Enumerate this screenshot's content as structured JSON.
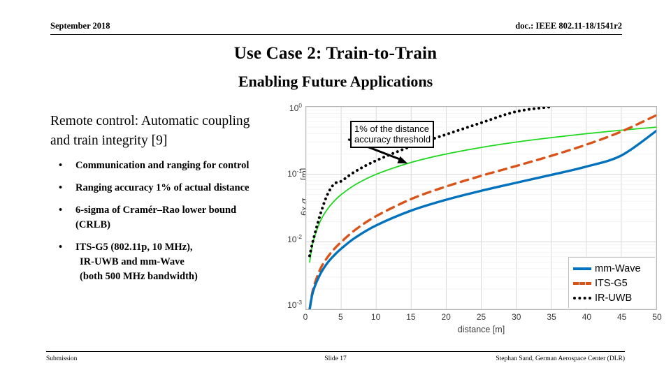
{
  "header": {
    "date": "September 2018",
    "doc": "doc.: IEEE 802.11-18/1541r2"
  },
  "title": {
    "main": "Use Case 2: Train-to-Train",
    "sub": "Enabling Future Applications"
  },
  "content": {
    "lead": "Remote control: Automatic coupling and train integrity [9]",
    "bullets": [
      {
        "marker": "•",
        "text": "Communication and ranging for control"
      },
      {
        "marker": "•",
        "text": "Ranging accuracy 1% of actual distance"
      },
      {
        "marker": "•",
        "text": "6-sigma of Cramér–Rao lower bound (CRLB)"
      },
      {
        "marker": "•",
        "text": "ITS-G5 (802.11p, 10 MHz),",
        "sub1": "IR-UWB and mm-Wave",
        "sub2": "(both 500 MHz bandwidth)"
      }
    ]
  },
  "figure": {
    "callout": {
      "line1": "1% of the distance",
      "line2": "accuracy threshold"
    },
    "yticks": [
      {
        "mant": "10",
        "exp": "0"
      },
      {
        "mant": "10",
        "exp": "-1"
      },
      {
        "mant": "10",
        "exp": "-2"
      },
      {
        "mant": "10",
        "exp": "-3"
      }
    ],
    "xticks": [
      "0",
      "5",
      "10",
      "15",
      "20",
      "25",
      "30",
      "35",
      "40",
      "45",
      "50"
    ]
  },
  "chart_data": {
    "type": "line",
    "title": "",
    "xlabel": "distance [m]",
    "ylabel": "6x σCRLB [m]",
    "yscale": "log",
    "xlim": [
      0,
      50
    ],
    "ylim": [
      0.001,
      1
    ],
    "grid": true,
    "legend_position": "bottom-right",
    "legend_entries": [
      "mm-Wave",
      "ITS-G5",
      "IR-UWB"
    ],
    "colors": {
      "mm_wave": "#0072bd",
      "its_g5": "#d95319",
      "ir_uwb": "#000000",
      "threshold": "#1ed81e"
    },
    "x": [
      0.5,
      1,
      2,
      3,
      4,
      5,
      7,
      10,
      15,
      20,
      25,
      30,
      35,
      40,
      45,
      50
    ],
    "series": [
      {
        "name": "mm-Wave",
        "style": "solid",
        "color": "#0072bd",
        "values": [
          0.001,
          0.00185,
          0.0033,
          0.0048,
          0.0063,
          0.0079,
          0.0115,
          0.0175,
          0.029,
          0.042,
          0.057,
          0.075,
          0.098,
          0.13,
          0.19,
          0.44
        ]
      },
      {
        "name": "ITS-G5",
        "style": "dashed",
        "color": "#d95319",
        "values": [
          0.001,
          0.002,
          0.0039,
          0.0058,
          0.0078,
          0.0099,
          0.015,
          0.024,
          0.043,
          0.066,
          0.095,
          0.133,
          0.188,
          0.275,
          0.43,
          0.75
        ]
      },
      {
        "name": "IR-UWB",
        "style": "dotted",
        "color": "#000000",
        "values": [
          0.0062,
          0.0105,
          0.025,
          0.049,
          0.072,
          0.079,
          0.11,
          0.16,
          0.26,
          0.39,
          0.58,
          0.85,
          1.0,
          null,
          null,
          null
        ]
      },
      {
        "name": "1% threshold",
        "style": "solid",
        "color": "#1ed81e",
        "in_legend": false,
        "values": [
          0.005,
          0.01,
          0.02,
          0.03,
          0.04,
          0.05,
          0.07,
          0.1,
          0.15,
          0.2,
          0.25,
          0.3,
          0.35,
          0.4,
          0.45,
          0.5
        ]
      }
    ],
    "annotation": {
      "text": "1% of the distance accuracy threshold",
      "arrow_from_x": 6,
      "arrow_to_x": 14.5,
      "arrow_to_y": 0.145
    }
  },
  "footer": {
    "left": "Submission",
    "center": "Slide 17",
    "right": "Stephan Sand, German Aerospace Center (DLR)"
  }
}
